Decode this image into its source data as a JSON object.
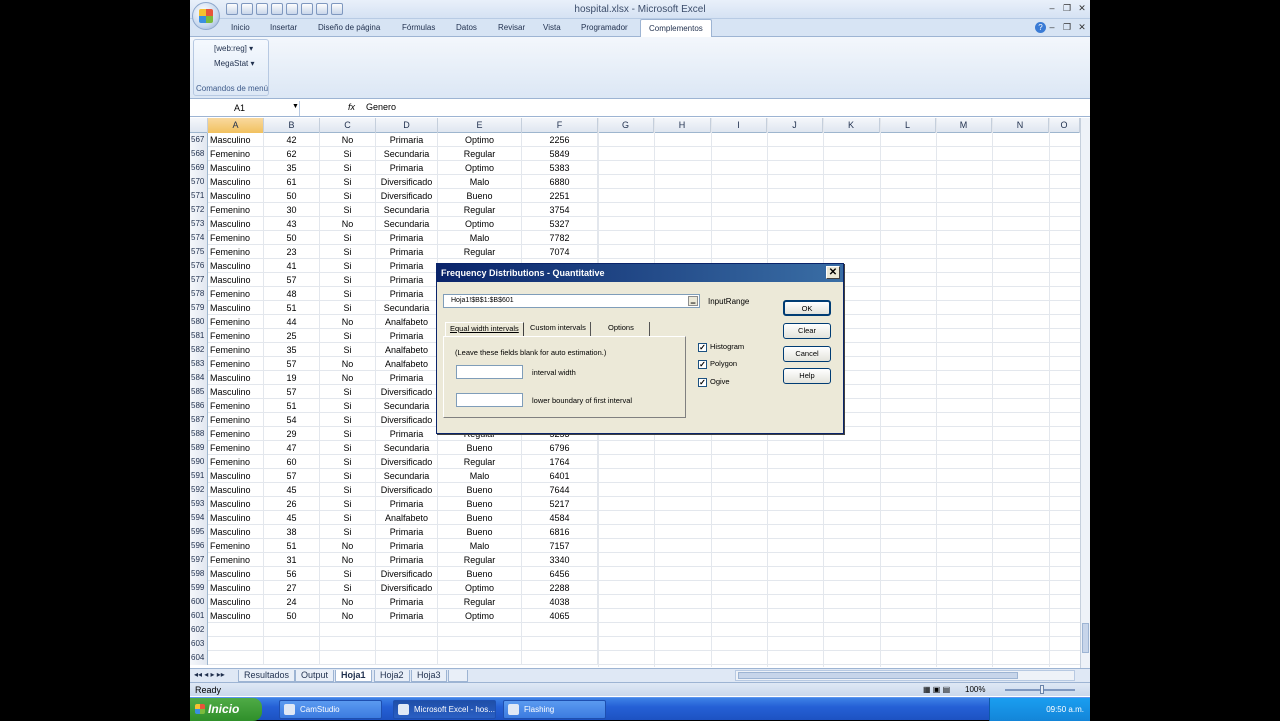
{
  "window": {
    "title": "hospital.xlsx - Microsoft Excel",
    "min": "–",
    "restore": "❐",
    "close": "✕",
    "inner_min": "–",
    "inner_restore": "❐",
    "inner_close": "✕"
  },
  "ribbon": {
    "tabs": [
      "Inicio",
      "Insertar",
      "Diseño de página",
      "Fórmulas",
      "Datos",
      "Revisar",
      "Vista",
      "Programador",
      "Complementos"
    ],
    "active_tab": "Complementos",
    "menu_items": [
      "[web:reg] ▾",
      "MegaStat ▾"
    ],
    "group_label": "Comandos de menú"
  },
  "formula_bar": {
    "name_box": "A1",
    "fx": "fx",
    "content": "Genero"
  },
  "columns": [
    "A",
    "B",
    "C",
    "D",
    "E",
    "F",
    "G",
    "H",
    "I",
    "J",
    "K",
    "L",
    "M",
    "N",
    "O"
  ],
  "rows": [
    [
      "567",
      "Masculino",
      "42",
      "No",
      "Primaria",
      "Optimo",
      "2256"
    ],
    [
      "568",
      "Femenino",
      "62",
      "Si",
      "Secundaria",
      "Regular",
      "5849"
    ],
    [
      "569",
      "Masculino",
      "35",
      "Si",
      "Primaria",
      "Optimo",
      "5383"
    ],
    [
      "570",
      "Masculino",
      "61",
      "Si",
      "Diversificado",
      "Malo",
      "6880"
    ],
    [
      "571",
      "Masculino",
      "50",
      "Si",
      "Diversificado",
      "Bueno",
      "2251"
    ],
    [
      "572",
      "Femenino",
      "30",
      "Si",
      "Secundaria",
      "Regular",
      "3754"
    ],
    [
      "573",
      "Masculino",
      "43",
      "No",
      "Secundaria",
      "Optimo",
      "5327"
    ],
    [
      "574",
      "Femenino",
      "50",
      "Si",
      "Primaria",
      "Malo",
      "7782"
    ],
    [
      "575",
      "Femenino",
      "23",
      "Si",
      "Primaria",
      "Regular",
      "7074"
    ],
    [
      "576",
      "Masculino",
      "41",
      "Si",
      "Primaria",
      "",
      ""
    ],
    [
      "577",
      "Masculino",
      "57",
      "Si",
      "Primaria",
      "",
      ""
    ],
    [
      "578",
      "Femenino",
      "48",
      "Si",
      "Primaria",
      "",
      ""
    ],
    [
      "579",
      "Masculino",
      "51",
      "Si",
      "Secundaria",
      "",
      ""
    ],
    [
      "580",
      "Femenino",
      "44",
      "No",
      "Analfabeto",
      "",
      ""
    ],
    [
      "581",
      "Femenino",
      "25",
      "Si",
      "Primaria",
      "",
      ""
    ],
    [
      "582",
      "Femenino",
      "35",
      "Si",
      "Analfabeto",
      "",
      ""
    ],
    [
      "583",
      "Femenino",
      "57",
      "No",
      "Analfabeto",
      "",
      ""
    ],
    [
      "584",
      "Masculino",
      "19",
      "No",
      "Primaria",
      "",
      ""
    ],
    [
      "585",
      "Masculino",
      "57",
      "Si",
      "Diversificado",
      "",
      ""
    ],
    [
      "586",
      "Femenino",
      "51",
      "Si",
      "Secundaria",
      "",
      ""
    ],
    [
      "587",
      "Femenino",
      "54",
      "Si",
      "Diversificado",
      "",
      ""
    ],
    [
      "588",
      "Femenino",
      "29",
      "Si",
      "Primaria",
      "Regular",
      "5253"
    ],
    [
      "589",
      "Femenino",
      "47",
      "Si",
      "Secundaria",
      "Bueno",
      "6796"
    ],
    [
      "590",
      "Femenino",
      "60",
      "Si",
      "Diversificado",
      "Regular",
      "1764"
    ],
    [
      "591",
      "Masculino",
      "57",
      "Si",
      "Secundaria",
      "Malo",
      "6401"
    ],
    [
      "592",
      "Masculino",
      "45",
      "Si",
      "Diversificado",
      "Bueno",
      "7644"
    ],
    [
      "593",
      "Masculino",
      "26",
      "Si",
      "Primaria",
      "Bueno",
      "5217"
    ],
    [
      "594",
      "Masculino",
      "45",
      "Si",
      "Analfabeto",
      "Bueno",
      "4584"
    ],
    [
      "595",
      "Masculino",
      "38",
      "Si",
      "Primaria",
      "Bueno",
      "6816"
    ],
    [
      "596",
      "Femenino",
      "51",
      "No",
      "Primaria",
      "Malo",
      "7157"
    ],
    [
      "597",
      "Femenino",
      "31",
      "No",
      "Primaria",
      "Regular",
      "3340"
    ],
    [
      "598",
      "Masculino",
      "56",
      "Si",
      "Diversificado",
      "Bueno",
      "6456"
    ],
    [
      "599",
      "Masculino",
      "27",
      "Si",
      "Diversificado",
      "Optimo",
      "2288"
    ],
    [
      "600",
      "Masculino",
      "24",
      "No",
      "Primaria",
      "Regular",
      "4038"
    ],
    [
      "601",
      "Masculino",
      "50",
      "No",
      "Primaria",
      "Optimo",
      "4065"
    ],
    [
      "602",
      "",
      "",
      "",
      "",
      "",
      ""
    ],
    [
      "603",
      "",
      "",
      "",
      "",
      "",
      ""
    ],
    [
      "604",
      "",
      "",
      "",
      "",
      "",
      ""
    ]
  ],
  "sheets": [
    "Resultados",
    "Output",
    "Hoja1",
    "Hoja2",
    "Hoja3"
  ],
  "active_sheet": "Hoja1",
  "status": {
    "ready": "Ready",
    "zoom": "100%"
  },
  "dialog": {
    "title": "Frequency Distributions - Quantitative",
    "close": "✕",
    "range_value": "Hoja1!$B$1:$B$601",
    "range_label": "InputRange",
    "tabs": [
      "Equal width intervals",
      "Custom intervals",
      "Options"
    ],
    "hint": "(Leave these fields  blank for auto estimation.)",
    "interval_width_label": "interval width",
    "lower_boundary_label": "lower boundary of first interval",
    "checkboxes": [
      {
        "label": "Histogram",
        "checked": true
      },
      {
        "label": "Polygon",
        "checked": true
      },
      {
        "label": "Ogive",
        "checked": true
      }
    ],
    "buttons": [
      "OK",
      "Clear",
      "Cancel",
      "Help"
    ]
  },
  "taskbar": {
    "start": "Inicio",
    "items": [
      "CamStudio",
      "Microsoft Excel - hos...",
      "Flashing"
    ],
    "clock": "09:50 a.m."
  }
}
